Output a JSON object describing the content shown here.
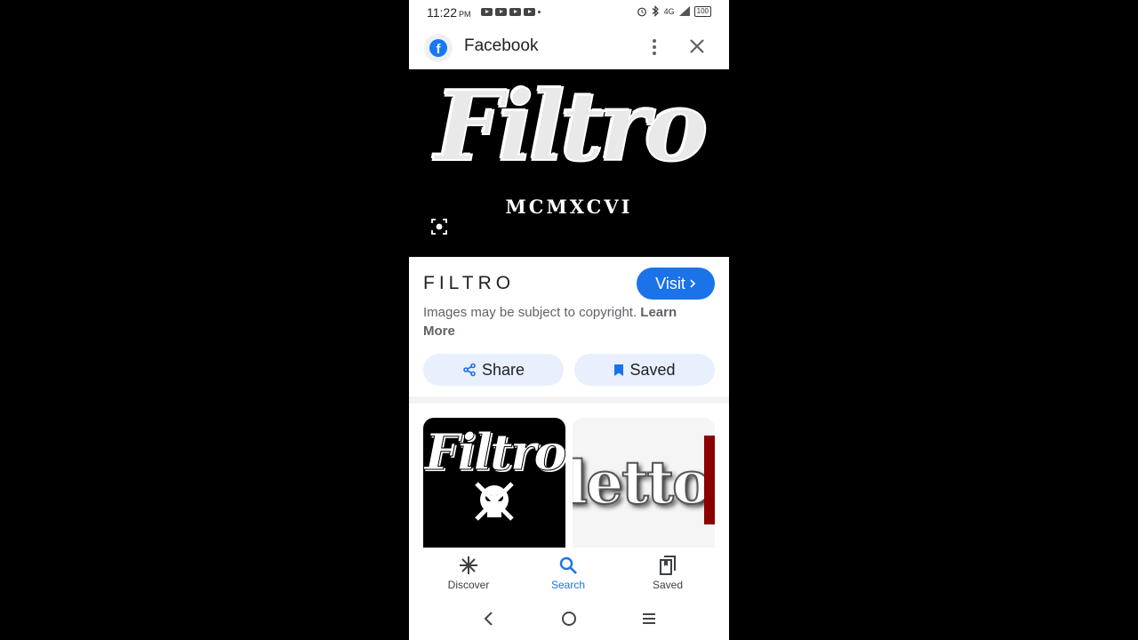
{
  "status_bar": {
    "time": "11:22",
    "ampm": "PM",
    "network": "4G",
    "battery": "100"
  },
  "header": {
    "title": "Facebook",
    "logo_letter": "f"
  },
  "hero": {
    "wordmark": "Filtro",
    "subtitle": "MCMXCVI"
  },
  "info": {
    "title": "FILTRO",
    "visit_label": "Visit",
    "copyright_text": "Images may be subject to copyright.",
    "learn_more": "Learn More",
    "share_label": "Share",
    "saved_label": "Saved"
  },
  "thumbnails": [
    {
      "text": "Filtro"
    },
    {
      "text": "letto"
    }
  ],
  "bottom_nav": [
    {
      "label": "Discover",
      "icon": "asterisk-icon"
    },
    {
      "label": "Search",
      "icon": "search-icon"
    },
    {
      "label": "Saved",
      "icon": "saved-collections-icon"
    }
  ],
  "colors": {
    "accent": "#1a73e8",
    "pill_bg": "#e8f0fe",
    "facebook_blue": "#1877f2"
  }
}
